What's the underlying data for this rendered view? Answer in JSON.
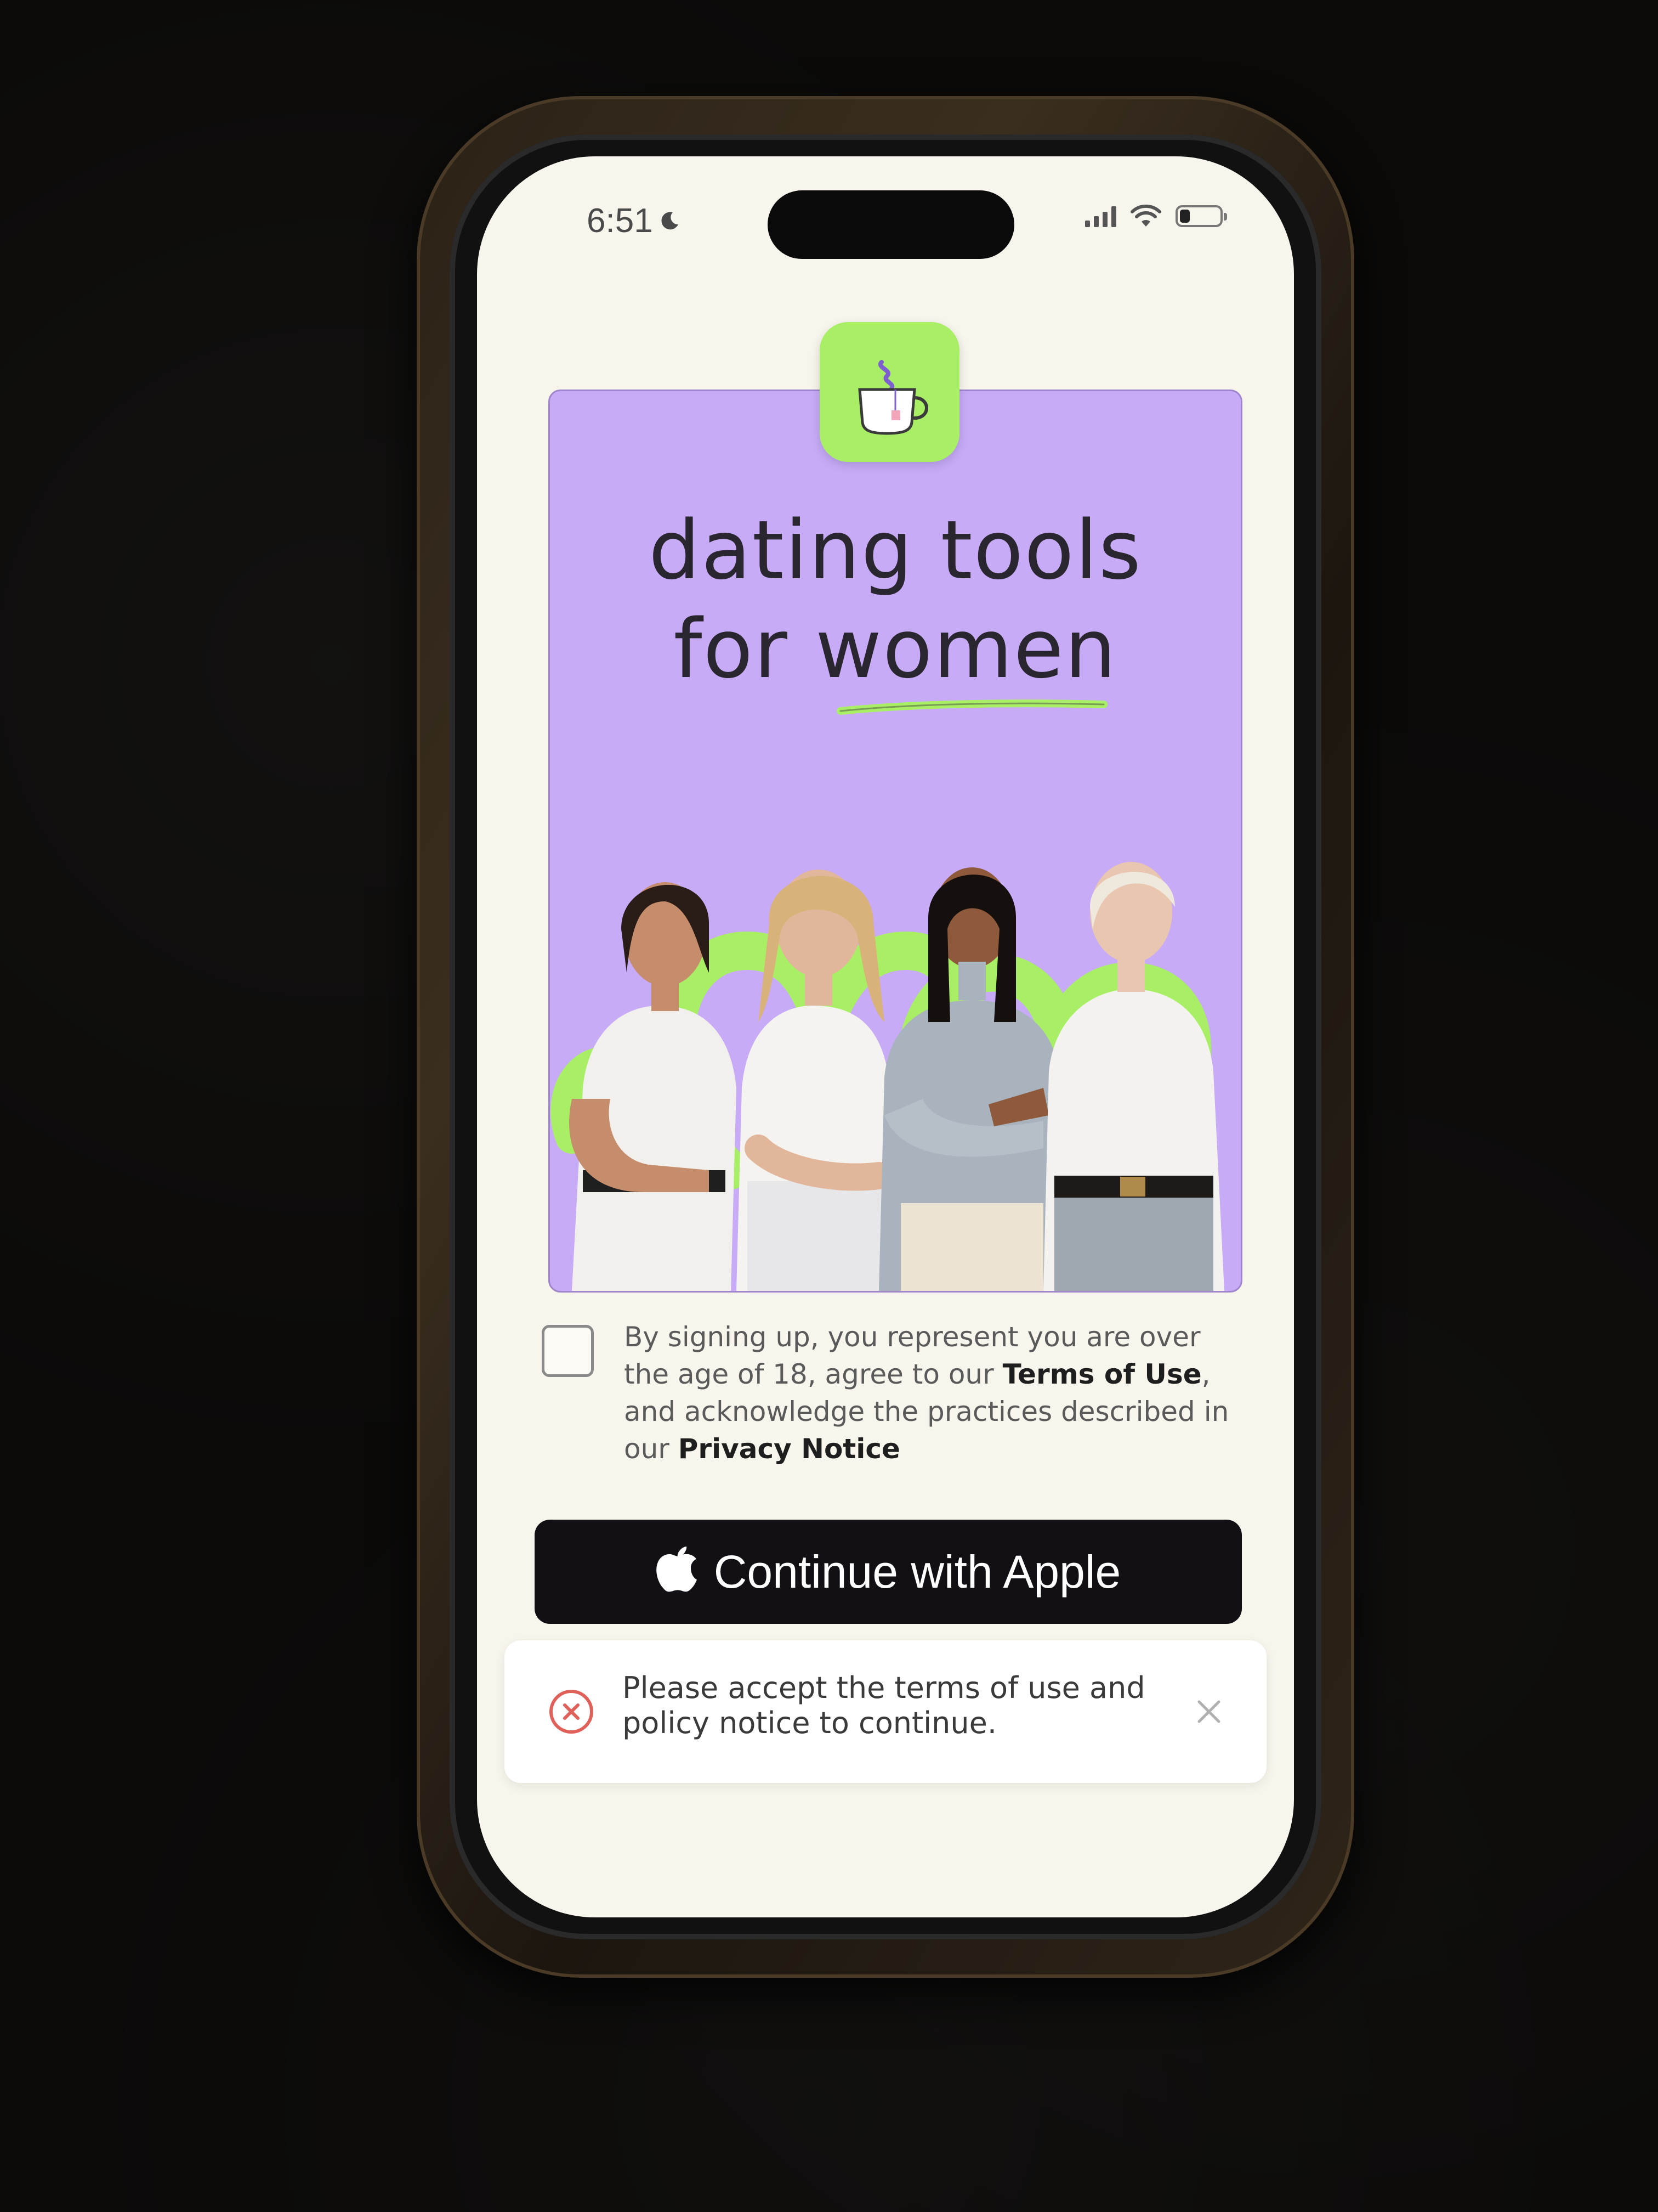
{
  "status_bar": {
    "time": "6:51"
  },
  "hero": {
    "title_line1": "dating tools",
    "title_line2": "for women",
    "accent_purple": "#c7abf7",
    "accent_green": "#a9ef66"
  },
  "app_icon": "teacup-icon",
  "terms": {
    "prefix": "By signing up, you represent you are over the age of 18, agree to our ",
    "terms_link": "Terms of Use",
    "middle": ", and acknowledge the practices described in our ",
    "privacy_link": "Privacy Notice",
    "checked": false
  },
  "apple_button": {
    "label": "Continue with Apple",
    "icon": "apple-icon"
  },
  "toast": {
    "message": "Please accept the terms of use and policy notice to continue.",
    "icon": "error-circle-icon",
    "close_icon": "close-icon"
  }
}
